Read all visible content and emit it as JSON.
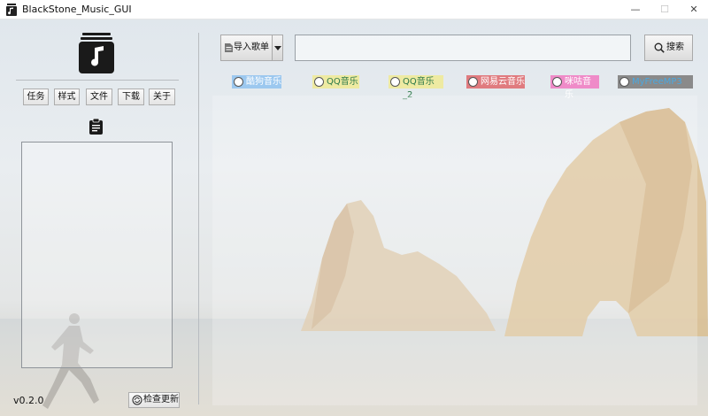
{
  "window": {
    "title": "BlackStone_Music_GUI",
    "controls": {
      "minimize": "—",
      "maximize": "☐",
      "close": "✕"
    }
  },
  "sidebar": {
    "menu": [
      {
        "label": "任务"
      },
      {
        "label": "样式"
      },
      {
        "label": "文件"
      },
      {
        "label": "下载"
      },
      {
        "label": "关于"
      }
    ],
    "version": "v0.2.0",
    "update_button": "检查更新"
  },
  "toolbar": {
    "import_button": "导入歌单",
    "search_value": "",
    "search_button": "搜索"
  },
  "sources": [
    {
      "label": "酷狗音乐",
      "color": "#9cc8ef",
      "text_color": "#ffffff"
    },
    {
      "label": "QQ音乐",
      "color": "#eeeaa2",
      "text_color": "#2e7a4a"
    },
    {
      "label": "QQ音乐_2",
      "color": "#eeeaa2",
      "text_color": "#2e7a4a"
    },
    {
      "label": "网易云音乐",
      "color": "#e07b7f",
      "text_color": "#ffffff"
    },
    {
      "label": "咪咕音乐",
      "color": "#ef8bc8",
      "text_color": "#ffffff"
    },
    {
      "label": "MyFreeMP3",
      "color": "#8a8a8a",
      "text_color": "#4aa8e0"
    }
  ],
  "icons": {
    "app": "music-stack-icon",
    "clipboard": "clipboard-icon",
    "search": "magnifier-icon",
    "import": "document-icon",
    "update": "refresh-icon"
  }
}
